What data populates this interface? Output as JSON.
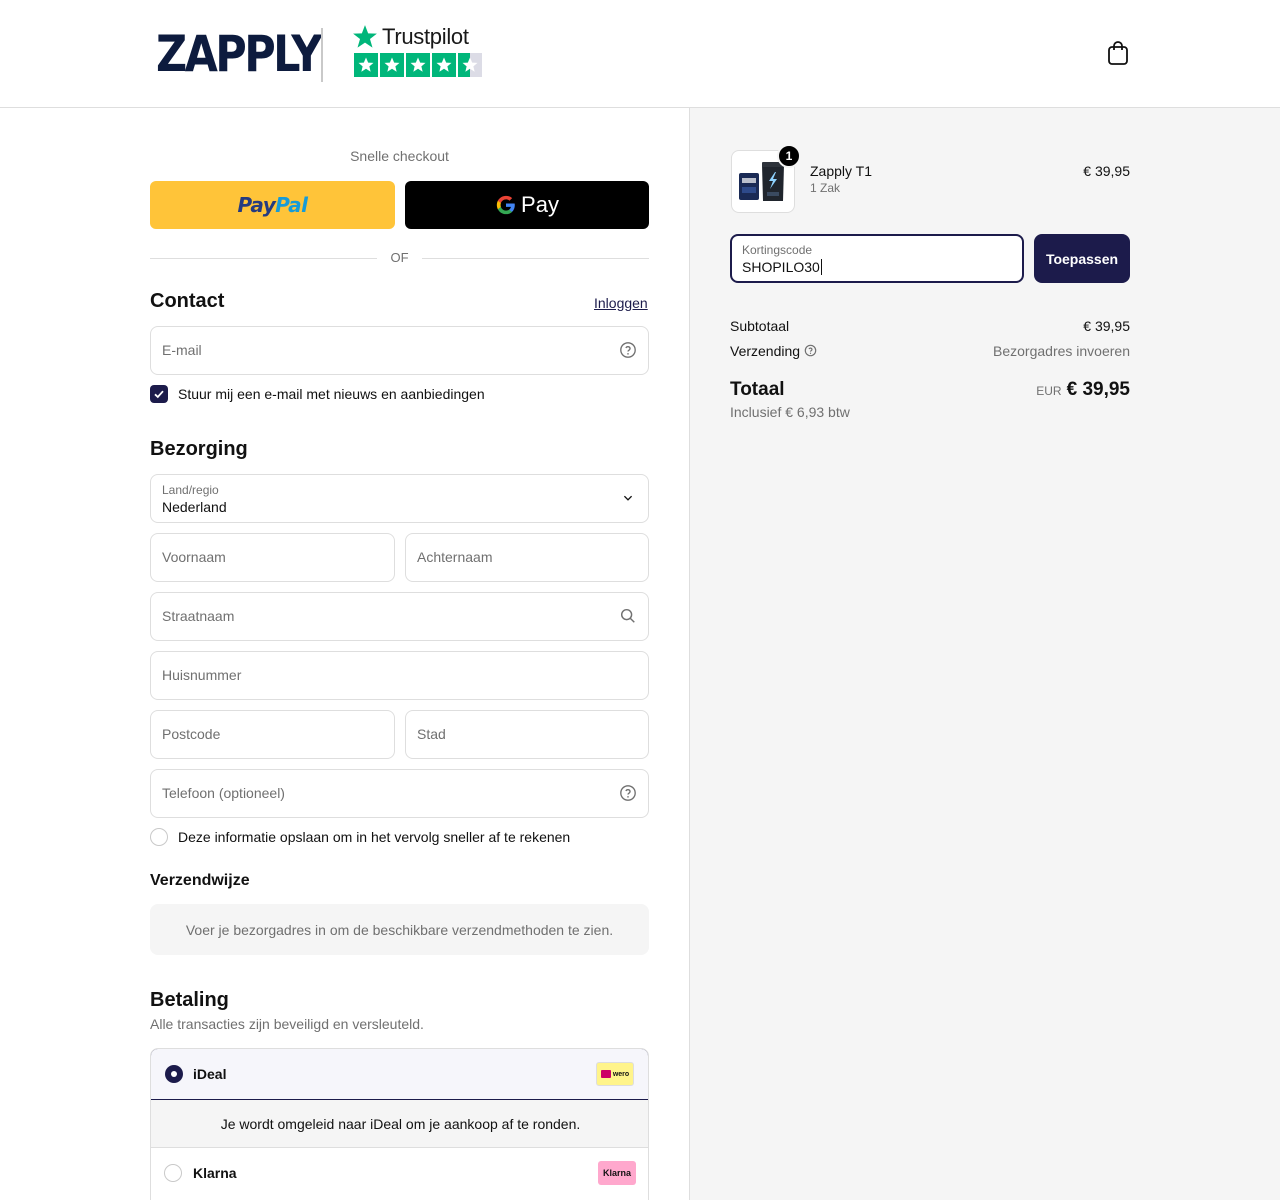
{
  "header": {
    "brand": "ZAPPLY",
    "trustpilot": {
      "label": "Trustpilot",
      "stars": 4.5
    },
    "cart_icon": "shopping-bag-icon"
  },
  "express": {
    "label": "Snelle checkout",
    "paypal_part1": "Pay",
    "paypal_part2": "Pal",
    "gpay_label": "Pay",
    "or_label": "OF"
  },
  "contact": {
    "title": "Contact",
    "login_link": "Inloggen",
    "email_placeholder": "E-mail",
    "newsletter_label": "Stuur mij een e-mail met nieuws en aanbiedingen",
    "newsletter_checked": true
  },
  "delivery": {
    "title": "Bezorging",
    "country_label": "Land/regio",
    "country_value": "Nederland",
    "first_name_placeholder": "Voornaam",
    "last_name_placeholder": "Achternaam",
    "street_placeholder": "Straatnaam",
    "house_number_placeholder": "Huisnummer",
    "postcode_placeholder": "Postcode",
    "city_placeholder": "Stad",
    "phone_placeholder": "Telefoon (optioneel)",
    "save_info_label": "Deze informatie opslaan om in het vervolg sneller af te rekenen",
    "save_info_checked": false
  },
  "shipping": {
    "title": "Verzendwijze",
    "notice": "Voer je bezorgadres in om de beschikbare verzendmethoden te zien."
  },
  "payment": {
    "title": "Betaling",
    "subtitle": "Alle transacties zijn beveiligd en versleuteld.",
    "options": [
      {
        "label": "iDeal",
        "selected": true,
        "badge": "wero"
      },
      {
        "label": "Klarna",
        "selected": false,
        "badge": "Klarna"
      }
    ],
    "ideal_redirect": "Je wordt omgeleid naar iDeal om je aankoop af te ronden."
  },
  "summary": {
    "product": {
      "name": "Zapply T1",
      "variant": "1 Zak",
      "price": "€ 39,95",
      "quantity": "1"
    },
    "discount_label": "Kortingscode",
    "discount_value": "SHOPILO30",
    "apply_label": "Toepassen",
    "subtotal_label": "Subtotaal",
    "subtotal_value": "€ 39,95",
    "shipping_label": "Verzending",
    "shipping_value": "Bezorgadres invoeren",
    "total_label": "Totaal",
    "currency": "EUR",
    "total_value": "€ 39,95",
    "tax_line": "Inclusief € 6,93 btw"
  },
  "colors": {
    "primary": "#1c1b4b",
    "paypal_yellow": "#ffc439",
    "trustpilot_green": "#00b67a",
    "brand_navy": "#0d1b3e"
  }
}
